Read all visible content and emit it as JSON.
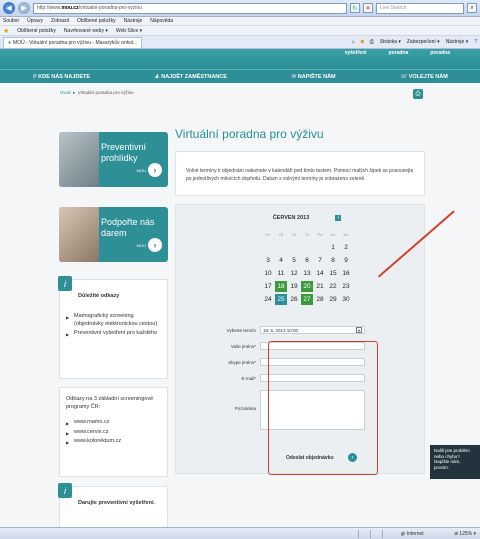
{
  "browser": {
    "url_prefix": "http://www.",
    "url_domain": "mou.cz",
    "url_rest": "/virtualni-poradna-pro-vyzivu",
    "search_placeholder": "Live Search",
    "menu": [
      "Soubor",
      "Úpravy",
      "Zobrazit",
      "Oblíbené položky",
      "Nástroje",
      "Nápověda"
    ],
    "favorites_label": "Oblíbené položky",
    "fav_items": [
      "Navrhované weby ▾",
      "Web Slice ▾"
    ],
    "tab_title": "MOÚ - Virtuální poradna pro výživu - Masarykův onkol...",
    "tools": [
      "Stránka ▾",
      "Zabezpečení ▾",
      "Nástroje ▾"
    ]
  },
  "site": {
    "top_links": [
      "vyšetření",
      "poradna",
      "poradna"
    ],
    "nav": [
      {
        "icon": "pin",
        "label": "KDE NÁS NAJDETE"
      },
      {
        "icon": "person",
        "label": "NAJDĚT ZAMĚSTNANCE"
      },
      {
        "icon": "mail",
        "label": "NAPIŠTE NÁM"
      },
      {
        "icon": "phone",
        "label": "VOLEJTE NÁM"
      }
    ],
    "breadcrumb_home": "Úvod",
    "breadcrumb_current": "Virtuální poradna pro výživu"
  },
  "sidebar": {
    "promo1": "Preventivní prohlídky",
    "promo2": "Podpořte nás darem",
    "promo_logo": "MOU",
    "links_title": "Důležité odkazy",
    "links": [
      "Mamografický screening (objednávky elektronickou cestou)",
      "Preventivní vyšetření pro každého"
    ],
    "screen_title": "Odkazy na 3 základní screeningové programy ČR:",
    "screen_links": [
      "www.mamo.cz",
      "www.cervix.cz",
      "www.kolorektum.cz"
    ],
    "bottom_title": "Darujte preventivní vyšetření."
  },
  "main": {
    "title": "Virtuální poradna pro výživu",
    "intro": "Volné termíny k objednání naleznete v kalendáři pod tímto textem. Pomocí malých šipek se posouvejte po jednotlivých měsících dopředu. Datum s volnými termíny je zobrazeno zeleně."
  },
  "calendar": {
    "month": "ČERVEN 2013",
    "day_names": [
      "Po",
      "Út",
      "St",
      "Čt",
      "Pá",
      "So",
      "Ne"
    ],
    "days": [
      "",
      "",
      "",
      "",
      "",
      "1",
      "2",
      "3",
      "4",
      "5",
      "6",
      "7",
      "8",
      "9",
      "10",
      "11",
      "12",
      "13",
      "14",
      "15",
      "16",
      "17",
      "18",
      "19",
      "20",
      "21",
      "22",
      "23",
      "24",
      "25",
      "26",
      "27",
      "28",
      "29",
      "30"
    ],
    "free_days": [
      "18",
      "20",
      "27"
    ],
    "selected_day": "25"
  },
  "form": {
    "term_label": "Vyberte termín",
    "term_value": "18. 6. 2013 10:00",
    "name_label": "Vaše jméno*",
    "skype_label": "Skype jméno*",
    "email_label": "E-mail*",
    "note_label": "Poznámka",
    "submit_label": "Odeslat objednávku"
  },
  "chat": {
    "text": "Našli jste problém nebo chybu? Napište nám, prosím."
  },
  "status": {
    "zone": "Internet",
    "zoom": "125%"
  }
}
